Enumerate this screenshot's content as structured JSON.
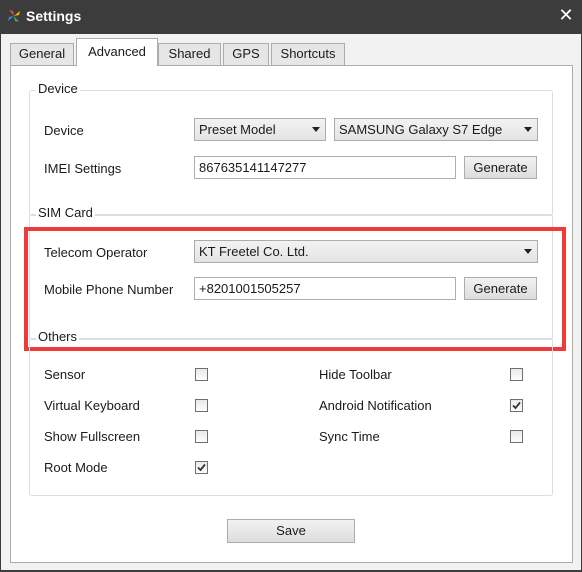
{
  "window": {
    "title": "Settings",
    "close_glyph": "✕"
  },
  "tabs": [
    {
      "label": "General"
    },
    {
      "label": "Advanced"
    },
    {
      "label": "Shared"
    },
    {
      "label": "GPS"
    },
    {
      "label": "Shortcuts"
    }
  ],
  "device": {
    "group_title": "Device",
    "device_label": "Device",
    "model_type": "Preset Model",
    "model_name": "SAMSUNG Galaxy S7 Edge",
    "imei_label": "IMEI Settings",
    "imei_value": "867635141147277",
    "generate_label": "Generate"
  },
  "sim": {
    "group_title": "SIM Card",
    "operator_label": "Telecom Operator",
    "operator_value": "KT Freetel Co. Ltd.",
    "phone_label": "Mobile Phone Number",
    "phone_value": "+8201001505257",
    "generate_label": "Generate"
  },
  "others": {
    "group_title": "Others",
    "options": [
      {
        "label": "Sensor",
        "checked": false
      },
      {
        "label": "Virtual Keyboard",
        "checked": false
      },
      {
        "label": "Show Fullscreen",
        "checked": false
      },
      {
        "label": "Root Mode",
        "checked": true
      },
      {
        "label": "Hide Toolbar",
        "checked": false
      },
      {
        "label": "Android Notification",
        "checked": true
      },
      {
        "label": "Sync Time",
        "checked": false
      }
    ]
  },
  "footer": {
    "save_label": "Save"
  },
  "colors": {
    "highlight": "#f03a3a",
    "titlebar": "#3c3c3c"
  },
  "icons": {
    "app": "app-logo-icon",
    "close": "close-icon",
    "dropdown": "chevron-down-icon",
    "check": "checkmark-icon"
  }
}
